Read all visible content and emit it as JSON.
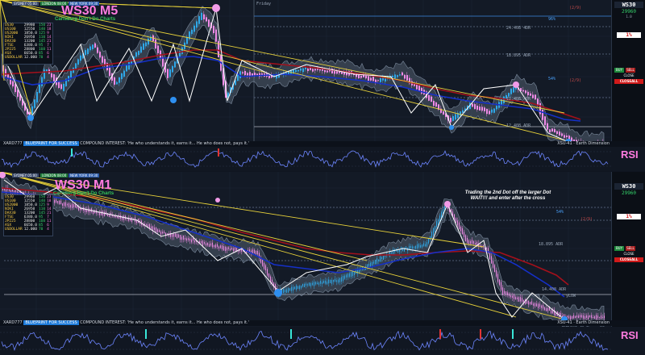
{
  "colors": {
    "background": "#131a26",
    "candle_up": "#2fa8e8",
    "candle_down": "#f08be8",
    "envelope": "#7f8ea3",
    "ma_fast": "#1530c8",
    "ma_slow": "#a3101b",
    "zigzag": "#ffffff",
    "trendline": "#e8d23a",
    "dot_top": "#f29be8",
    "dot_bottom": "#2e8ff0",
    "rsi_line": "#6d86ff",
    "title": "#ff7ce0"
  },
  "top_chart": {
    "title": "WS30 M5",
    "subtitle": "Carlsberg Don't Do Charts",
    "sessions": [
      "SYDNEY 05:00",
      "LONDON 08:00",
      "NEW YORK 09:30"
    ],
    "day_label": "Friday",
    "stats_rows": [
      [
        "US30",
        "29980",
        "150",
        "23"
      ],
      [
        "US100",
        "12550",
        "140",
        "18"
      ],
      [
        "US2000",
        "1850.0",
        "125",
        "9"
      ],
      [
        "NIKI",
        "26950",
        "110",
        "14"
      ],
      [
        "DAX30",
        "13200",
        "145",
        "21"
      ],
      [
        "FTSE",
        "6380.0",
        "95",
        "7"
      ],
      [
        "JP225",
        "28800",
        "160",
        "11"
      ],
      [
        "ASX",
        "6650.0",
        "85",
        "6"
      ],
      [
        "USDOLLAR",
        "12.000",
        "70",
        "4"
      ]
    ],
    "level_labels": [
      "24.408 4DR",
      "18.895 ADR",
      "12.408 ADR",
      "12.408 ADR"
    ],
    "pct_labels": [
      "96%",
      "54%",
      "(2/9)",
      "(2/9)"
    ],
    "right_panel": {
      "symbol": "WS30",
      "price": "29960",
      "spread": "1.0",
      "pct_badge": "1%",
      "close_label": "CLOSE",
      "close_all_label": "CLOSEALL",
      "buy_label": "BUY",
      "sell_label": "SELL"
    },
    "footer": {
      "prefix": "XARD777",
      "highlight": "BLUEPRINT FOR SUCCESS",
      "text": "COMPOUND INTEREST: 'He who understands it, earns it... He who does not, pays it.'",
      "right": "XSU-41 · Earth Dimension"
    }
  },
  "top_rsi": {
    "label": "RSI"
  },
  "bottom_chart": {
    "title": "WS30 M1",
    "subtitle": "Carlsberg Don't Do Charts",
    "sessions": [
      "SYDNEY 05:00",
      "LONDON 08:00",
      "NEW YORK 09:30"
    ],
    "stats_rows": [
      [
        "US30",
        "29960",
        "150",
        "23"
      ],
      [
        "US100",
        "12550",
        "140",
        "18"
      ],
      [
        "US2000",
        "1850.0",
        "125",
        "9"
      ],
      [
        "NIKI",
        "26950",
        "110",
        "14"
      ],
      [
        "DAX30",
        "13200",
        "145",
        "21"
      ],
      [
        "FTSE",
        "6380.0",
        "95",
        "7"
      ],
      [
        "JP225",
        "28800",
        "160",
        "11"
      ],
      [
        "ASX",
        "6650.0",
        "85",
        "6"
      ],
      [
        "USDOLLAR",
        "12.000",
        "70",
        "4"
      ]
    ],
    "annotation_line1": "Trading the 2nd Dot off the larger Dot",
    "annotation_line2": "WAIT!!! and enter after the cross",
    "level_labels": [
      "18.895 ADR",
      "14.408 ADR",
      "yLOW"
    ],
    "pct_labels": [
      "54%",
      "(2/9)"
    ],
    "right_panel": {
      "symbol": "WS30",
      "price": "29960",
      "pct_badge": "1%",
      "close_label": "CLOSE",
      "close_all_label": "CLOSEALL",
      "buy_label": "BUY",
      "sell_label": "SELL"
    },
    "footer": {
      "prefix": "XARD777",
      "highlight": "BLUEPRINT FOR SUCCESS",
      "text": "COMPOUND INTEREST: 'He who understands it, earns it... He who does not, pays it.'",
      "right": "XSU-41 · Earth Dimension"
    }
  },
  "bottom_rsi": {
    "label": "RSI"
  }
}
